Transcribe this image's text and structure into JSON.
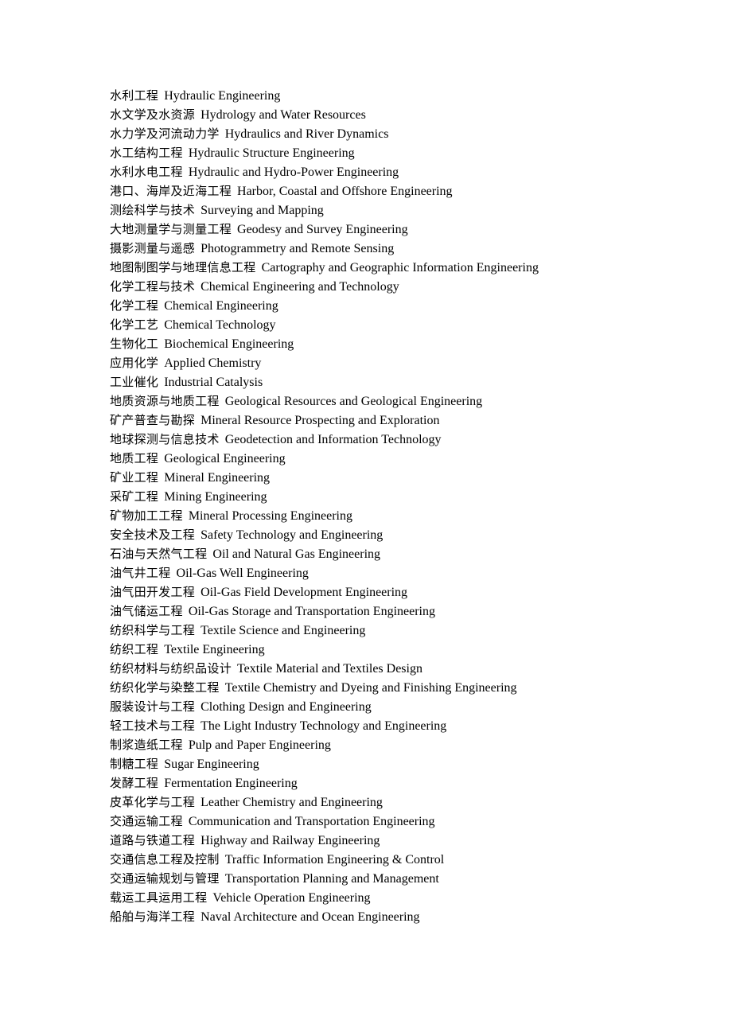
{
  "document": {
    "page_background": "#ffffff",
    "text_color": "#000000",
    "entries": [
      {
        "cn": "水利工程",
        "en": "Hydraulic Engineering"
      },
      {
        "cn": "水文学及水资源",
        "en": "Hydrology and Water Resources"
      },
      {
        "cn": "水力学及河流动力学",
        "en": "Hydraulics and River Dynamics"
      },
      {
        "cn": "水工结构工程",
        "en": "Hydraulic Structure Engineering"
      },
      {
        "cn": "水利水电工程",
        "en": "Hydraulic and Hydro-Power Engineering"
      },
      {
        "cn": "港口、海岸及近海工程",
        "en": "Harbor, Coastal and Offshore Engineering"
      },
      {
        "cn": "测绘科学与技术",
        "en": "Surveying and Mapping"
      },
      {
        "cn": "大地测量学与测量工程",
        "en": "Geodesy and Survey Engineering"
      },
      {
        "cn": "摄影测量与遥感",
        "en": "Photogrammetry and Remote Sensing"
      },
      {
        "cn": "地图制图学与地理信息工程",
        "en": "Cartography and Geographic Information Engineering"
      },
      {
        "cn": "化学工程与技术",
        "en": "Chemical Engineering and Technology"
      },
      {
        "cn": "化学工程",
        "en": "Chemical Engineering"
      },
      {
        "cn": "化学工艺",
        "en": "Chemical Technology"
      },
      {
        "cn": "生物化工",
        "en": "Biochemical Engineering"
      },
      {
        "cn": "应用化学",
        "en": "Applied Chemistry"
      },
      {
        "cn": "工业催化",
        "en": "Industrial Catalysis"
      },
      {
        "cn": "地质资源与地质工程",
        "en": "Geological Resources and Geological Engineering"
      },
      {
        "cn": "矿产普查与勘探",
        "en": "Mineral Resource Prospecting and Exploration"
      },
      {
        "cn": "地球探测与信息技术",
        "en": "Geodetection and Information Technology"
      },
      {
        "cn": "地质工程",
        "en": "Geological Engineering"
      },
      {
        "cn": "矿业工程",
        "en": "Mineral Engineering"
      },
      {
        "cn": "采矿工程",
        "en": "Mining Engineering"
      },
      {
        "cn": "矿物加工工程",
        "en": "Mineral Processing Engineering"
      },
      {
        "cn": "安全技术及工程",
        "en": "Safety Technology and Engineering"
      },
      {
        "cn": "石油与天然气工程",
        "en": "Oil and Natural Gas Engineering"
      },
      {
        "cn": "油气井工程",
        "en": "Oil-Gas Well Engineering"
      },
      {
        "cn": "油气田开发工程",
        "en": "Oil-Gas Field Development Engineering"
      },
      {
        "cn": "油气储运工程",
        "en": "Oil-Gas Storage and Transportation Engineering"
      },
      {
        "cn": "纺织科学与工程",
        "en": "Textile Science and Engineering"
      },
      {
        "cn": "纺织工程",
        "en": "Textile Engineering"
      },
      {
        "cn": "纺织材料与纺织品设计",
        "en": "Textile Material and Textiles Design"
      },
      {
        "cn": "纺织化学与染整工程",
        "en": "Textile Chemistry and Dyeing and Finishing Engineering"
      },
      {
        "cn": "服装设计与工程",
        "en": "Clothing Design and Engineering"
      },
      {
        "cn": "轻工技术与工程",
        "en": "The Light Industry Technology and Engineering"
      },
      {
        "cn": "制浆造纸工程",
        "en": "Pulp and Paper Engineering"
      },
      {
        "cn": "制糖工程",
        "en": "Sugar Engineering"
      },
      {
        "cn": "发酵工程",
        "en": "Fermentation Engineering"
      },
      {
        "cn": "皮革化学与工程",
        "en": "Leather Chemistry and Engineering"
      },
      {
        "cn": "交通运输工程",
        "en": "Communication and Transportation Engineering"
      },
      {
        "cn": "道路与铁道工程",
        "en": "Highway and Railway Engineering"
      },
      {
        "cn": "交通信息工程及控制",
        "en": "Traffic Information Engineering & Control"
      },
      {
        "cn": "交通运输规划与管理",
        "en": "Transportation Planning and Management"
      },
      {
        "cn": "载运工具运用工程",
        "en": "Vehicle Operation Engineering"
      },
      {
        "cn": "船舶与海洋工程",
        "en": "Naval Architecture and Ocean Engineering"
      }
    ]
  }
}
